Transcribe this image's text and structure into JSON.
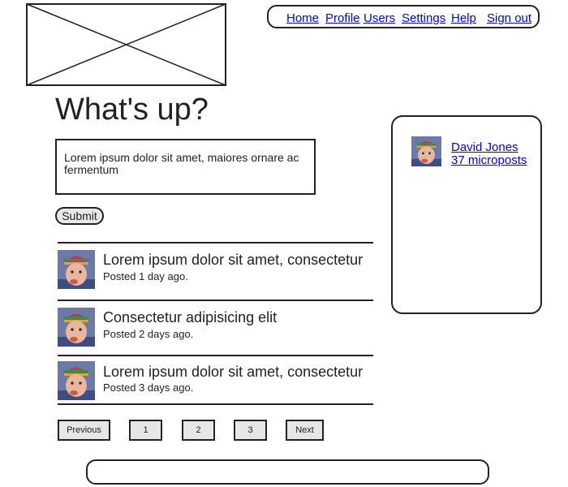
{
  "nav": {
    "items": [
      {
        "label": "Home"
      },
      {
        "label": "Profile"
      },
      {
        "label": "Users"
      },
      {
        "label": "Settings"
      },
      {
        "label": "Help"
      },
      {
        "label": "Sign out"
      }
    ]
  },
  "main": {
    "title": "What's up?",
    "micropost_value": "Lorem ipsum dolor sit amet, maiores ornare ac fermentum",
    "submit_label": "Submit"
  },
  "feed": [
    {
      "content": "Lorem ipsum dolor sit amet, consectetur",
      "time": "Posted 1 day ago."
    },
    {
      "content": "Consectetur adipisicing elit",
      "time": "Posted 2 days ago."
    },
    {
      "content": "Lorem ipsum dolor sit amet, consectetur",
      "time": "Posted 3 days ago."
    }
  ],
  "pagination": {
    "previous": "Previous",
    "pages": [
      "1",
      "2",
      "3"
    ],
    "next": "Next"
  },
  "sidebar": {
    "user_name": "David Jones",
    "micropost_count": "37 microposts"
  },
  "icons": {
    "logo": "image-placeholder-icon",
    "avatar": "user-avatar-photo"
  },
  "colors": {
    "link": "#0000ee",
    "border": "#222222",
    "button_bg": "#e6e6e6"
  }
}
